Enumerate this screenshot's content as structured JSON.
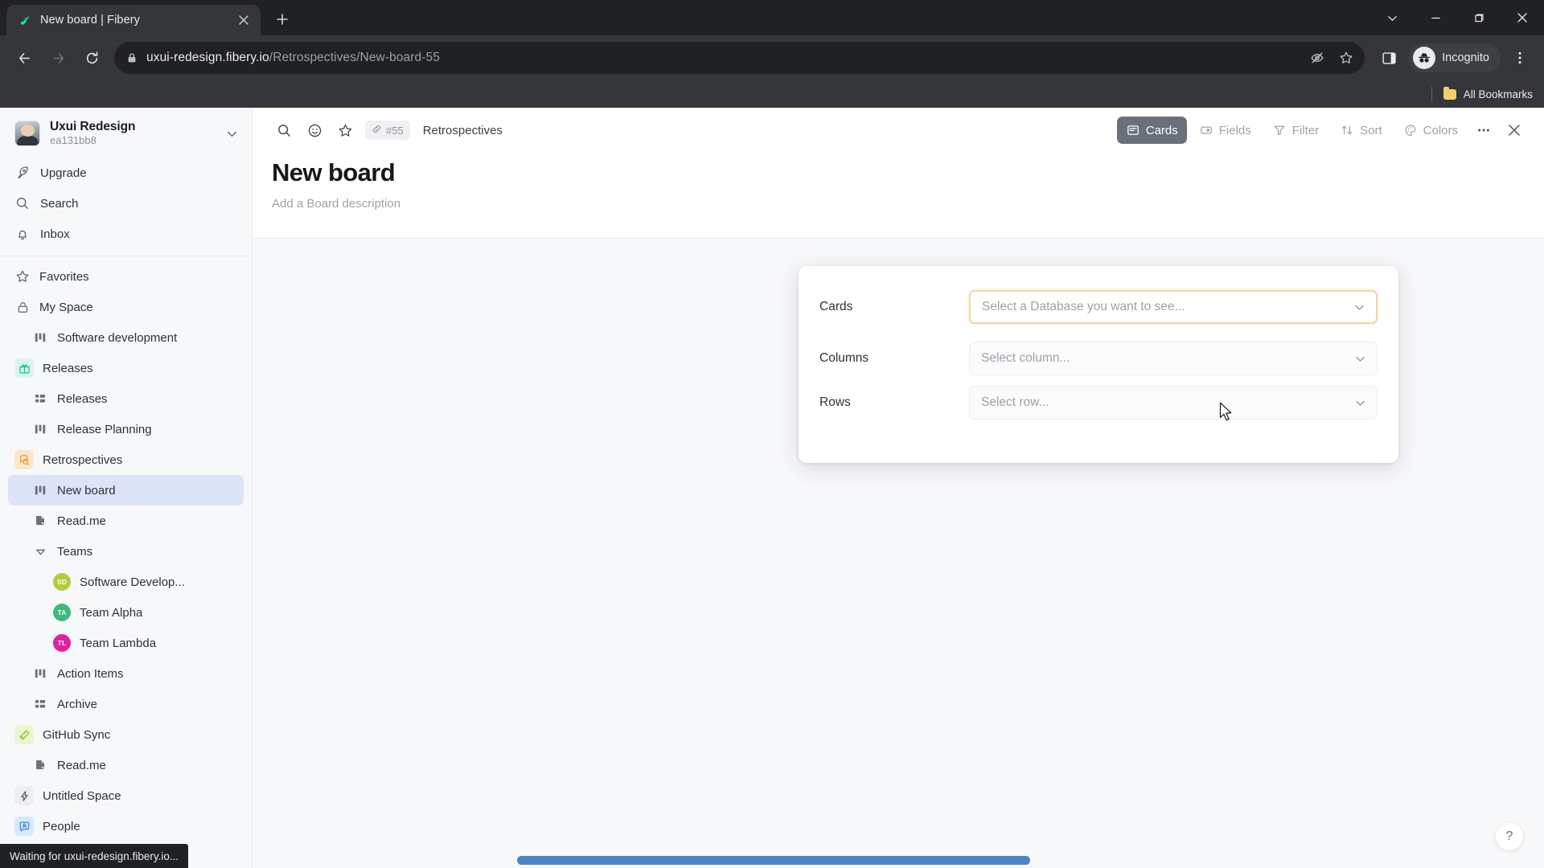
{
  "browser": {
    "tab": {
      "title": "New board | Fibery",
      "favicon_icon": "fibery-leaf-icon",
      "close_icon": "close-icon"
    },
    "new_tab_label": "+",
    "window_controls": [
      "chevron-down-icon",
      "minimize-icon",
      "restore-icon",
      "close-icon"
    ],
    "nav": {
      "back_icon": "back-arrow-icon",
      "forward_icon": "forward-arrow-icon",
      "reload_icon": "reload-icon"
    },
    "omnibox": {
      "lock_icon": "lock-icon",
      "url_host": "uxui-redesign.fibery.io",
      "url_path": "/Retrospectives/New-board-55",
      "tracking_icon": "eye-crossed-icon",
      "bookmark_icon": "star-icon"
    },
    "side_panel_icon": "side-panel-icon",
    "profile": {
      "label": "Incognito",
      "icon": "incognito-icon"
    },
    "menu_icon": "kebab-menu-icon",
    "bookmarks": {
      "label": "All Bookmarks",
      "icon": "folder-icon"
    }
  },
  "sidebar": {
    "workspace": {
      "name": "Uxui Redesign",
      "id": "ea131bb8",
      "chevron_icon": "chevron-down-icon",
      "avatar_icon": "user-avatar"
    },
    "nav": [
      {
        "label": "Upgrade",
        "icon": "rocket-icon"
      },
      {
        "label": "Search",
        "icon": "search-icon"
      },
      {
        "label": "Inbox",
        "icon": "bell-icon"
      }
    ],
    "tree": [
      {
        "label": "Favorites",
        "icon": "star-icon",
        "level": 0,
        "type": "nav"
      },
      {
        "label": "My Space",
        "icon": "lock-icon",
        "level": 0,
        "type": "nav"
      },
      {
        "label": "Software development",
        "icon": "board-icon",
        "level": 1,
        "type": "view"
      },
      {
        "label": "Releases",
        "icon": "gift-icon",
        "level": 0,
        "type": "space",
        "color": "#d7f5ec",
        "fg": "#1fbf9c"
      },
      {
        "label": "Releases",
        "icon": "grid-icon",
        "level": 1,
        "type": "view"
      },
      {
        "label": "Release Planning",
        "icon": "board-icon",
        "level": 1,
        "type": "view"
      },
      {
        "label": "Retrospectives",
        "icon": "feedback-icon",
        "level": 0,
        "type": "space",
        "color": "#fde7c9",
        "fg": "#e8951d"
      },
      {
        "label": "New board",
        "icon": "board-icon",
        "level": 1,
        "type": "view",
        "selected": true
      },
      {
        "label": "Read.me",
        "icon": "document-icon",
        "level": 1,
        "type": "doc"
      },
      {
        "label": "Teams",
        "icon": "caret-down-icon",
        "level": 1,
        "type": "group"
      },
      {
        "label": "Software Develop...",
        "icon": "avatar-SD",
        "level": 2,
        "type": "entity",
        "color": "#b5cc3a",
        "initials": "SD"
      },
      {
        "label": "Team Alpha",
        "icon": "avatar-TA",
        "level": 2,
        "type": "entity",
        "color": "#3cba7c",
        "initials": "TA"
      },
      {
        "label": "Team Lambda",
        "icon": "avatar-TL",
        "level": 2,
        "type": "entity",
        "color": "#e0219c",
        "initials": "TL"
      },
      {
        "label": "Action Items",
        "icon": "board-icon",
        "level": 1,
        "type": "view"
      },
      {
        "label": "Archive",
        "icon": "grid-icon",
        "level": 1,
        "type": "view"
      },
      {
        "label": "GitHub Sync",
        "icon": "sync-icon",
        "level": 0,
        "type": "space",
        "color": "#eaf6cd",
        "fg": "#8bbf2e"
      },
      {
        "label": "Read.me",
        "icon": "document-icon",
        "level": 1,
        "type": "doc"
      },
      {
        "label": "Untitled Space",
        "icon": "bolt-icon",
        "level": 0,
        "type": "space",
        "color": "#eceef1",
        "fg": "#4a4f58"
      },
      {
        "label": "People",
        "icon": "people-icon",
        "level": 0,
        "type": "space",
        "color": "#d6e8fb",
        "fg": "#2f7fd1"
      }
    ]
  },
  "main": {
    "toolbar_left": {
      "search_icon": "search-icon",
      "emoji_icon": "emoji-icon",
      "favorite_icon": "star-icon",
      "link_icon": "link-icon",
      "entity_id": "#55",
      "breadcrumb": "Retrospectives"
    },
    "view_tools": [
      {
        "label": "Cards",
        "icon": "cards-icon",
        "active": true
      },
      {
        "label": "Fields",
        "icon": "fields-icon",
        "active": false
      },
      {
        "label": "Filter",
        "icon": "filter-icon",
        "active": false
      },
      {
        "label": "Sort",
        "icon": "sort-icon",
        "active": false
      },
      {
        "label": "Colors",
        "icon": "colors-icon",
        "active": false
      }
    ],
    "more_icon": "more-horizontal-icon",
    "close_icon": "close-icon",
    "board": {
      "title": "New board",
      "description": "Add a Board description"
    }
  },
  "popup": {
    "rows": [
      {
        "label": "Cards",
        "placeholder": "Select a Database you want to see...",
        "focused": true
      },
      {
        "label": "Columns",
        "placeholder": "Select column...",
        "focused": false
      },
      {
        "label": "Rows",
        "placeholder": "Select row...",
        "focused": false
      }
    ],
    "chevron_icon": "chevron-down-icon"
  },
  "overlays": {
    "help_label": "?",
    "status_text": "Waiting for uxui-redesign.fibery.io...",
    "scrollbar_color": "#4a84c4"
  }
}
